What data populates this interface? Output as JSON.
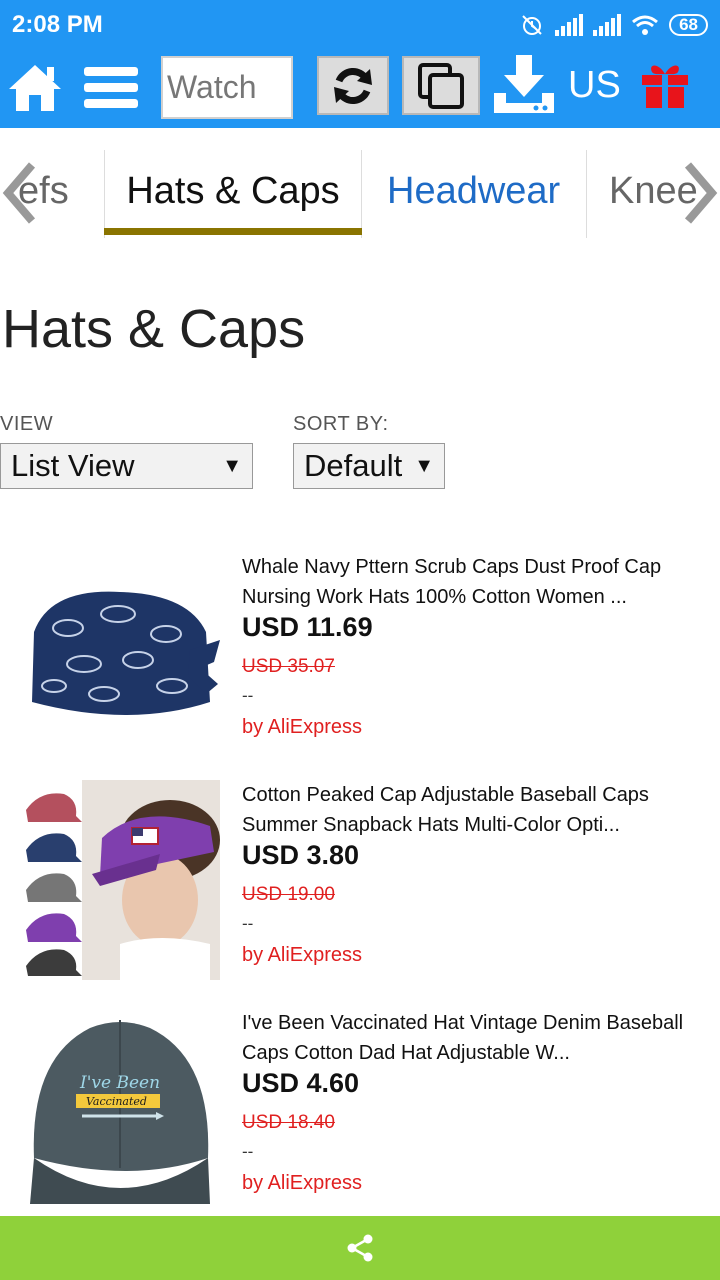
{
  "status_bar": {
    "time": "2:08 PM",
    "battery": "68"
  },
  "toolbar": {
    "watch_placeholder": "Watch",
    "region": "US",
    "colors": {
      "bar": "#2196f3",
      "gift": "#e8141b"
    }
  },
  "tabs": {
    "prev_partial": "efs",
    "active": "Hats & Caps",
    "next": "Headwear",
    "next_partial": "Knee"
  },
  "page": {
    "title": "Hats & Caps",
    "view_label": "VIEW",
    "view_value": "List View",
    "sort_label": "SORT BY:",
    "sort_value": "Default"
  },
  "products": [
    {
      "title": "Whale Navy Pttern Scrub Caps Dust Proof Cap Nursing Work Hats 100% Cotton Women ...",
      "price": "USD 11.69",
      "old_price": "USD 35.07",
      "dash": "--",
      "source": "by AliExpress",
      "image_icon": "navy-scrub-cap-image"
    },
    {
      "title": "Cotton Peaked Cap Adjustable Baseball Caps Summer Snapback Hats Multi-Color Opti...",
      "price": "USD 3.80",
      "old_price": "USD 19.00",
      "dash": "--",
      "source": "by AliExpress",
      "image_icon": "baseball-caps-image"
    },
    {
      "title": "I've Been Vaccinated Hat Vintage Denim Baseball Caps Cotton Dad Hat Adjustable W...",
      "price": "USD 4.60",
      "old_price": "USD 18.40",
      "dash": "--",
      "source": "by AliExpress",
      "image_icon": "denim-cap-image",
      "image_text_1": "I've Been",
      "image_text_2": "Vaccinated"
    }
  ],
  "share_bar": {
    "color": "#8fd13a",
    "icon": "share-icon"
  }
}
